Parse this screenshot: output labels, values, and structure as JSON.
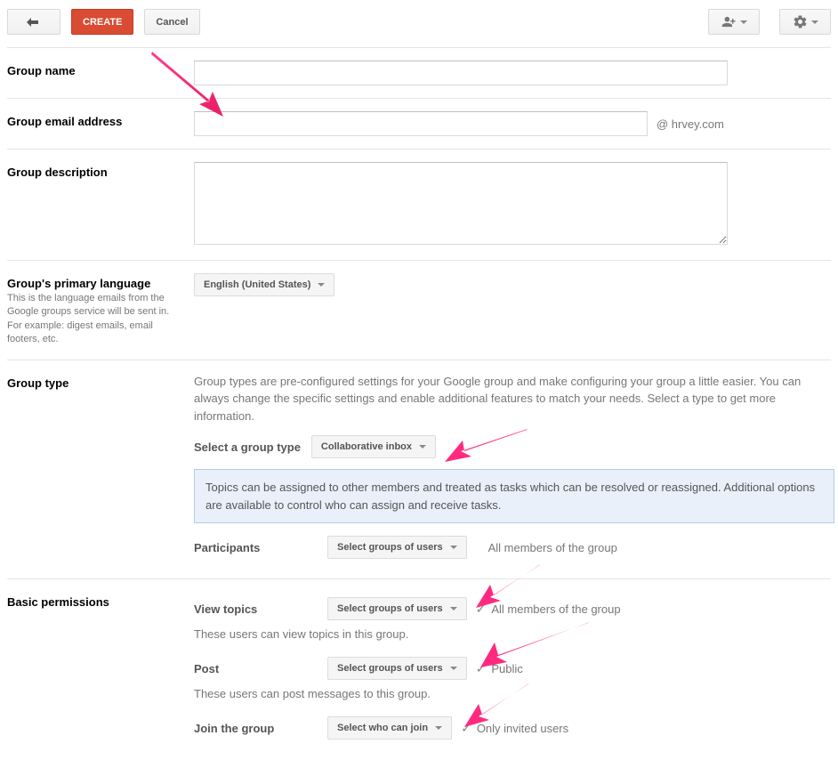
{
  "toolbar": {
    "create_label": "CREATE",
    "cancel_label": "Cancel"
  },
  "fields": {
    "group_name": {
      "label": "Group name",
      "value": ""
    },
    "group_email": {
      "label": "Group email address",
      "value": "",
      "suffix": "@ hrvey.com"
    },
    "group_description": {
      "label": "Group description",
      "value": ""
    },
    "primary_language": {
      "label": "Group's primary language",
      "desc": "This is the language emails from the Google groups service will be sent in. For example: digest emails, email footers, etc.",
      "selected": "English (United States)"
    }
  },
  "group_type": {
    "label": "Group type",
    "help": "Group types are pre-configured settings for your Google group and make configuring your group a little easier. You can always change the specific settings and enable additional features to match your needs. Select a type to get more information.",
    "select_label": "Select a group type",
    "selected": "Collaborative inbox",
    "info": "Topics can be assigned to other members and treated as tasks which can be resolved or reassigned. Additional options are available to control who can assign and receive tasks.",
    "participants": {
      "label": "Participants",
      "dropdown": "Select groups of users",
      "status": "All members of the group"
    }
  },
  "permissions": {
    "label": "Basic permissions",
    "view_topics": {
      "label": "View topics",
      "dropdown": "Select groups of users",
      "status": "All members of the group",
      "help": "These users can view topics in this group."
    },
    "post": {
      "label": "Post",
      "dropdown": "Select groups of users",
      "status": "Public",
      "help": "These users can post messages to this group."
    },
    "join": {
      "label": "Join the group",
      "dropdown": "Select who can join",
      "status": "Only invited users"
    }
  }
}
